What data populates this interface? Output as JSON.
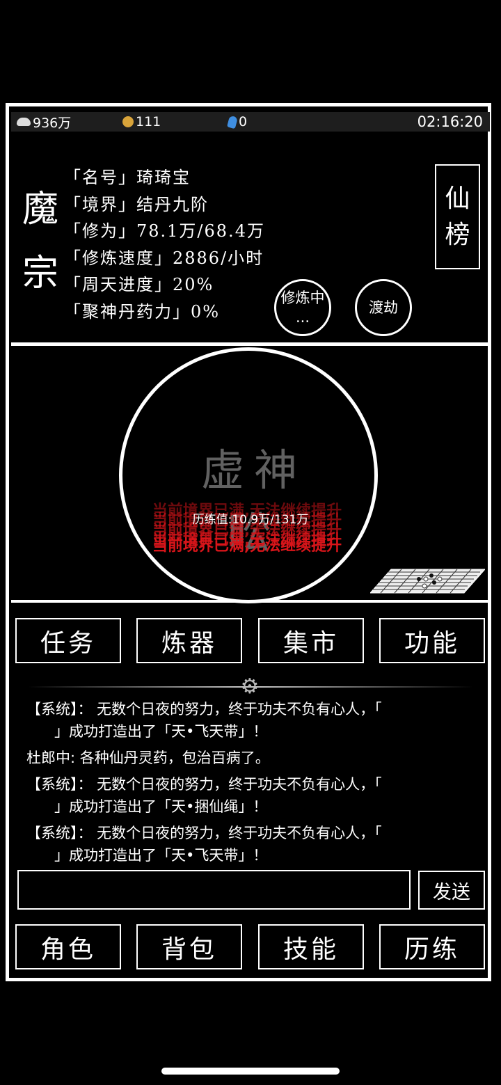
{
  "status": {
    "silver": "936万",
    "gold": "111",
    "gems": "0",
    "clock": "02:16:20"
  },
  "sect": {
    "line1": "魔",
    "line2": "宗"
  },
  "profile": {
    "name": "「名号」琦琦宝",
    "realm": "「境界」结丹九阶",
    "cultivation": "「修为」78.1万/68.4万",
    "speed": "「修炼速度」2886/小时",
    "cycle": "「周天进度」20%",
    "pill": "「聚神丹药力」0%"
  },
  "rank_button": {
    "l1": "仙",
    "l2": "榜"
  },
  "cultivating_button": {
    "l1": "修炼中",
    "l2": "..."
  },
  "tribulation_button": "渡劫",
  "scene": {
    "watermark": "虚神 昖",
    "exp": "历练值:10.9万/131万",
    "warning": "当前境界已满,无法继续提升"
  },
  "top_nav": [
    "任务",
    "炼器",
    "集市",
    "功能"
  ],
  "chat": [
    {
      "l1": "【系统】： 无数个日夜的努力，终于功夫不负有心人，「",
      "l2": "」成功打造出了「天•飞天带」！"
    },
    {
      "l1": "杜郎中: 各种仙丹灵药，包治百病了。",
      "l2": ""
    },
    {
      "l1": "【系统】： 无数个日夜的努力，终于功夫不负有心人，「",
      "l2": "」成功打造出了「天•捆仙绳」！"
    },
    {
      "l1": "【系统】： 无数个日夜的努力，终于功夫不负有心人，「",
      "l2": "」成功打造出了「天•飞天带」！"
    }
  ],
  "send_label": "发送",
  "bottom_nav": [
    "角色",
    "背包",
    "技能",
    "历练"
  ]
}
